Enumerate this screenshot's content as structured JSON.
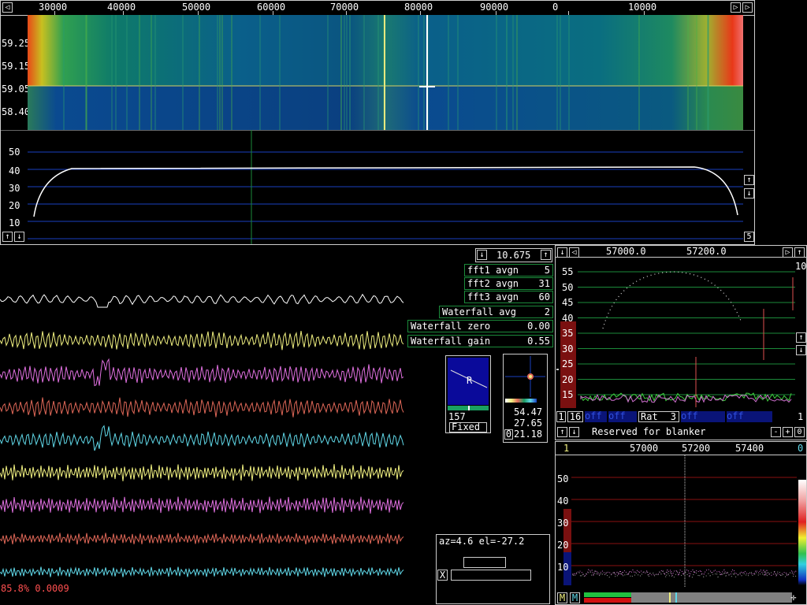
{
  "main_spectrum": {
    "freq_ticks": [
      "30000",
      "40000",
      "50000",
      "60000",
      "70000",
      "80000",
      "90000",
      "0",
      "10000"
    ],
    "waterfall_time_labels": [
      "59.25",
      "59.15",
      "59.05",
      "58.40"
    ],
    "db_labels": [
      "50",
      "40",
      "30",
      "20",
      "10"
    ],
    "right_index": "5"
  },
  "params": {
    "reference": "10.675",
    "fft1_label": "fft1 avgn",
    "fft1_value": "5",
    "fft2_label": "fft2 avgn",
    "fft2_value": "31",
    "fft3_label": "fft3 avgn",
    "fft3_value": "60",
    "wf_avg_label": "Waterfall avg",
    "wf_avg_value": "2",
    "wf_zero_label": "Waterfall zero",
    "wf_zero_value": "0.00",
    "wf_gain_label": "Waterfall gain",
    "wf_gain_value": "0.55"
  },
  "coherent": {
    "freq_ticks": [
      "57000.0",
      "57200.0"
    ],
    "db_labels": [
      "55",
      "50",
      "45",
      "40",
      "35",
      "30",
      "25",
      "20",
      "15"
    ],
    "right_top": "10",
    "ctrl_1": "1",
    "ctrl_16": "16",
    "ctrl_rat": "Rat",
    "ctrl_rat_value": "3",
    "ctrl_off": "off",
    "right_one": "1",
    "blanker_text": "Reserved for blanker",
    "minus": "-",
    "plus": "+",
    "zero": "0"
  },
  "afc": {
    "top_left": "1",
    "top_right": "0",
    "freq_ticks": [
      "57000",
      "57200",
      "57400"
    ],
    "db_labels": [
      "50",
      "40",
      "30",
      "20",
      "10"
    ],
    "m1": "M",
    "m2": "M"
  },
  "pol": {
    "angle": "157",
    "mode": "Fixed",
    "v1": "54.47",
    "v2": "27.65",
    "v3": "21.18",
    "zero": "0",
    "r_glyph": "R"
  },
  "moon": {
    "position": "az=4.6 el=-27.2",
    "x_label": "X"
  },
  "status": {
    "text": "85.8% 0.0009"
  },
  "colors": {
    "trace_white": "#ffffff",
    "trace_yellow": "#f0f080",
    "trace_magenta": "#e070e0",
    "trace_red": "#e06858",
    "trace_cyan": "#60d8e8",
    "grid_blue": "#1a3fc0",
    "grid_red": "#8a1010",
    "grid_green": "#1b8a3a"
  }
}
